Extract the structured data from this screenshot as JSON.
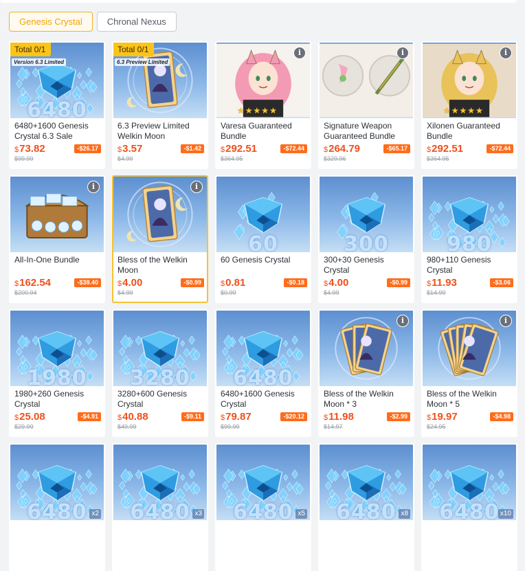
{
  "tabs": [
    {
      "label": "Genesis Crystal",
      "active": true
    },
    {
      "label": "Chronal Nexus",
      "active": false
    }
  ],
  "cards": [
    {
      "title": "6480+1600 Genesis Crystal 6.3 Sale",
      "currency": "$",
      "price": "73.82",
      "discount": "-$26.17",
      "original": "$99.99",
      "badge": "Total 0/1",
      "tag": "Version 6.3 Limited",
      "art": "crystal",
      "number": "6480",
      "info": false
    },
    {
      "title": "6.3 Preview Limited Welkin Moon",
      "currency": "$",
      "price": "3.57",
      "discount": "-$1.42",
      "original": "$4.99",
      "badge": "Total 0/1",
      "tag": "6.3 Preview Limited",
      "art": "welkin",
      "info": false
    },
    {
      "title": "Varesa Guaranteed Bundle",
      "currency": "$",
      "price": "292.51",
      "discount": "-$72.44",
      "original": "$364.95",
      "art": "char-pink",
      "stars": 5,
      "info": true
    },
    {
      "title": "Signature Weapon Guaranteed Bundle",
      "currency": "$",
      "price": "264.79",
      "discount": "-$65.17",
      "original": "$329.96",
      "art": "weapon",
      "info": true
    },
    {
      "title": "Xilonen Guaranteed Bundle",
      "currency": "$",
      "price": "292.51",
      "discount": "-$72.44",
      "original": "$364.95",
      "art": "char-blonde",
      "stars": 5,
      "info": true
    },
    {
      "title": "All-In-One Bundle",
      "currency": "$",
      "price": "162.54",
      "discount": "-$38.40",
      "original": "$200.94",
      "art": "chest",
      "chest_label": "GENESIS CRYSTAL",
      "info": true
    },
    {
      "title": "Bless of the Welkin Moon",
      "currency": "$",
      "price": "4.00",
      "discount": "-$0.99",
      "original": "$4.99",
      "art": "welkin",
      "info": true,
      "selected": true
    },
    {
      "title": "60 Genesis Crystal",
      "currency": "$",
      "price": "0.81",
      "discount": "-$0.18",
      "original": "$0.99",
      "art": "crystal-small",
      "number": "60",
      "info": false
    },
    {
      "title": "300+30 Genesis Crystal",
      "currency": "$",
      "price": "4.00",
      "discount": "-$0.99",
      "original": "$4.99",
      "art": "crystal-small",
      "number": "300",
      "info": false
    },
    {
      "title": "980+110 Genesis Crystal",
      "currency": "$",
      "price": "11.93",
      "discount": "-$3.06",
      "original": "$14.99",
      "art": "crystal",
      "number": "980",
      "info": false
    },
    {
      "title": "1980+260 Genesis Crystal",
      "currency": "$",
      "price": "25.08",
      "discount": "-$4.91",
      "original": "$29.99",
      "art": "crystal",
      "number": "1980",
      "info": false
    },
    {
      "title": "3280+600 Genesis Crystal",
      "currency": "$",
      "price": "40.88",
      "discount": "-$9.11",
      "original": "$49.99",
      "art": "crystal",
      "number": "3280",
      "info": false
    },
    {
      "title": "6480+1600 Genesis Crystal",
      "currency": "$",
      "price": "79.87",
      "discount": "-$20.12",
      "original": "$99.99",
      "art": "crystal",
      "number": "6480",
      "info": false
    },
    {
      "title": "Bless of the Welkin Moon * 3",
      "currency": "$",
      "price": "11.98",
      "discount": "-$2.99",
      "original": "$14.97",
      "art": "welkin-fan3",
      "info": true
    },
    {
      "title": "Bless of the Welkin Moon * 5",
      "currency": "$",
      "price": "19.97",
      "discount": "-$4.98",
      "original": "$24.95",
      "art": "welkin-fan5",
      "info": true
    },
    {
      "title": "",
      "art": "crystal",
      "number": "6480",
      "mult": "x2",
      "info": false,
      "partial": true
    },
    {
      "title": "",
      "art": "crystal",
      "number": "6480",
      "mult": "x3",
      "info": false,
      "partial": true
    },
    {
      "title": "",
      "art": "crystal",
      "number": "6480",
      "mult": "x5",
      "info": false,
      "partial": true
    },
    {
      "title": "",
      "art": "crystal",
      "number": "6480",
      "mult": "x8",
      "info": false,
      "partial": true
    },
    {
      "title": "",
      "art": "crystal",
      "number": "6480",
      "mult": "x10",
      "info": false,
      "partial": true
    }
  ],
  "colors": {
    "accent": "#f5b21b",
    "price": "#f04f1c",
    "discount": "#ff6c1a",
    "badge": "#fcc419"
  }
}
